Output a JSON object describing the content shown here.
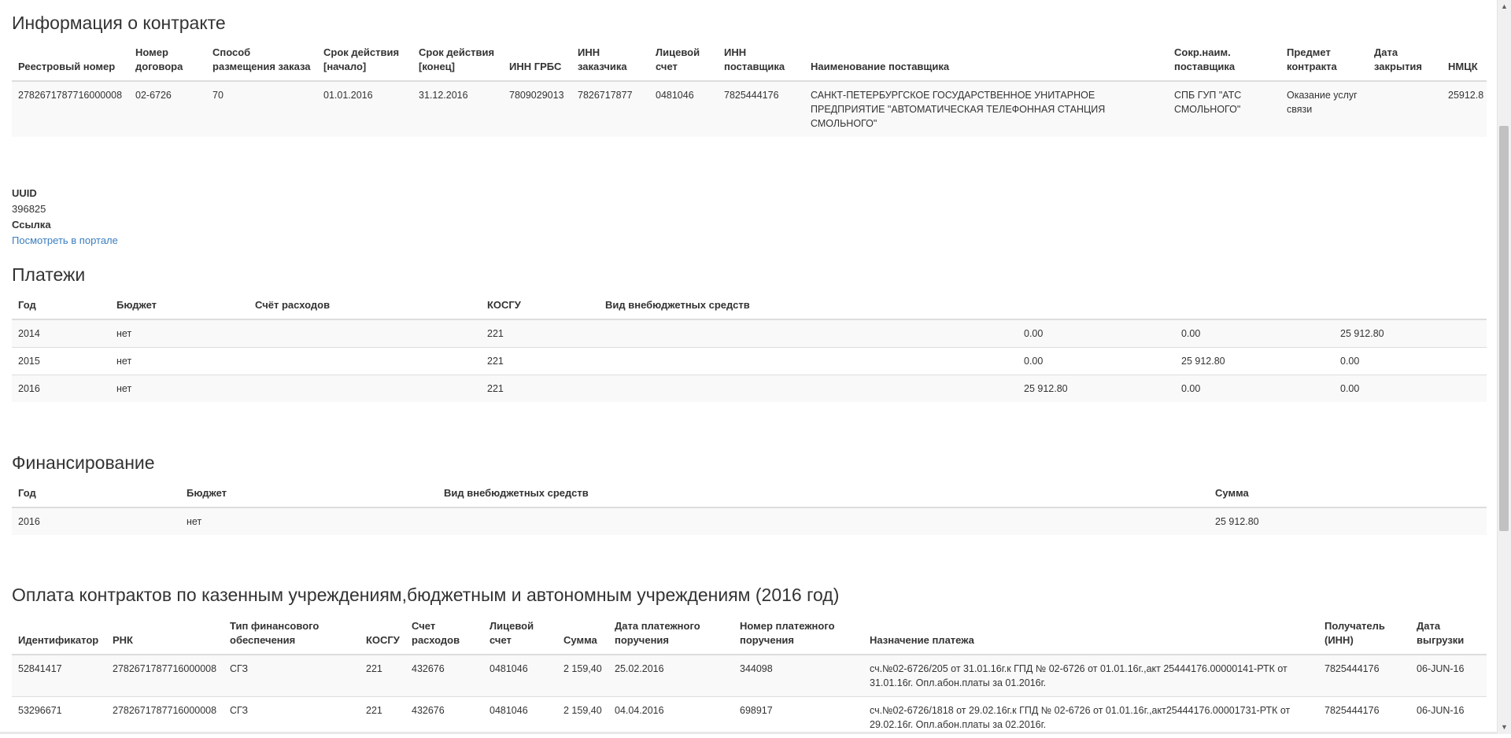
{
  "contract": {
    "title": "Информация о контракте",
    "headers": [
      "Реестровый номер",
      "Номер договора",
      "Способ размещения заказа",
      "Срок действия [начало]",
      "Срок действия [конец]",
      "ИНН ГРБС",
      "ИНН заказчика",
      "Лицевой счет",
      "ИНН поставщика",
      "Наименование поставщика",
      "Сокр.наим. поставщика",
      "Предмет контракта",
      "Дата закрытия",
      "НМЦК"
    ],
    "row": [
      "2782671787716000008",
      "02-6726",
      "70",
      "01.01.2016",
      "31.12.2016",
      "7809029013",
      "7826717877",
      "0481046",
      "7825444176",
      "САНКТ-ПЕТЕРБУРГСКОЕ ГОСУДАРСТВЕННОЕ УНИТАРНОЕ ПРЕДПРИЯТИЕ \"АВТОМАТИЧЕСКАЯ ТЕЛЕФОННАЯ СТАНЦИЯ СМОЛЬНОГО\"",
      "СПБ ГУП \"АТС СМОЛЬНОГО\"",
      "Оказание услуг связи",
      "",
      "25912.8"
    ]
  },
  "meta": {
    "uuid_label": "UUID",
    "uuid_value": "396825",
    "link_label": "Ссылка",
    "link_text": "Посмотреть в портале"
  },
  "payments": {
    "title": "Платежи",
    "headers": [
      "Год",
      "Бюджет",
      "Счёт расходов",
      "КОСГУ",
      "Вид внебюджетных средств",
      "",
      "",
      ""
    ],
    "rows": [
      [
        "2014",
        "нет",
        "",
        "221",
        "",
        "0.00",
        "0.00",
        "25 912.80"
      ],
      [
        "2015",
        "нет",
        "",
        "221",
        "",
        "0.00",
        "25 912.80",
        "0.00"
      ],
      [
        "2016",
        "нет",
        "",
        "221",
        "",
        "25 912.80",
        "0.00",
        "0.00"
      ]
    ]
  },
  "financing": {
    "title": "Финансирование",
    "headers": [
      "Год",
      "Бюджет",
      "Вид внебюджетных средств",
      "Сумма"
    ],
    "rows": [
      [
        "2016",
        "нет",
        "",
        "25 912.80"
      ]
    ]
  },
  "contract_payments": {
    "title": "Оплата контрактов по казенным учреждениям,бюджетным и автономным учреждениям (2016 год)",
    "headers": [
      "Идентификатор",
      "РНК",
      "Тип финансового обеспечения",
      "КОСГУ",
      "Счет расходов",
      "Лицевой счет",
      "Сумма",
      "Дата платежного поручения",
      "Номер платежного поручения",
      "Назначение платежа",
      "Получатель (ИНН)",
      "Дата выгрузки"
    ],
    "rows": [
      [
        "52841417",
        "2782671787716000008",
        "СГЗ",
        "221",
        "432676",
        "0481046",
        "2 159,40",
        "25.02.2016",
        "344098",
        "сч.№02-6726/205 от 31.01.16г.к ГПД № 02-6726 от 01.01.16г.,акт 25444176.00000141-РТК от 31.01.16г. Опл.абон.платы за 01.2016г.",
        "7825444176",
        "06-JUN-16"
      ],
      [
        "53296671",
        "2782671787716000008",
        "СГЗ",
        "221",
        "432676",
        "0481046",
        "2 159,40",
        "04.04.2016",
        "698917",
        "сч.№02-6726/1818 от 29.02.16г.к ГПД № 02-6726 от 01.01.16г.,акт25444176.00001731-РТК от 29.02.16г. Опл.абон.платы за 02.2016г.",
        "7825444176",
        "06-JUN-16"
      ]
    ]
  },
  "scrollbar": {
    "up_icon": "triangle-up-icon",
    "down_icon": "triangle-down-icon"
  }
}
